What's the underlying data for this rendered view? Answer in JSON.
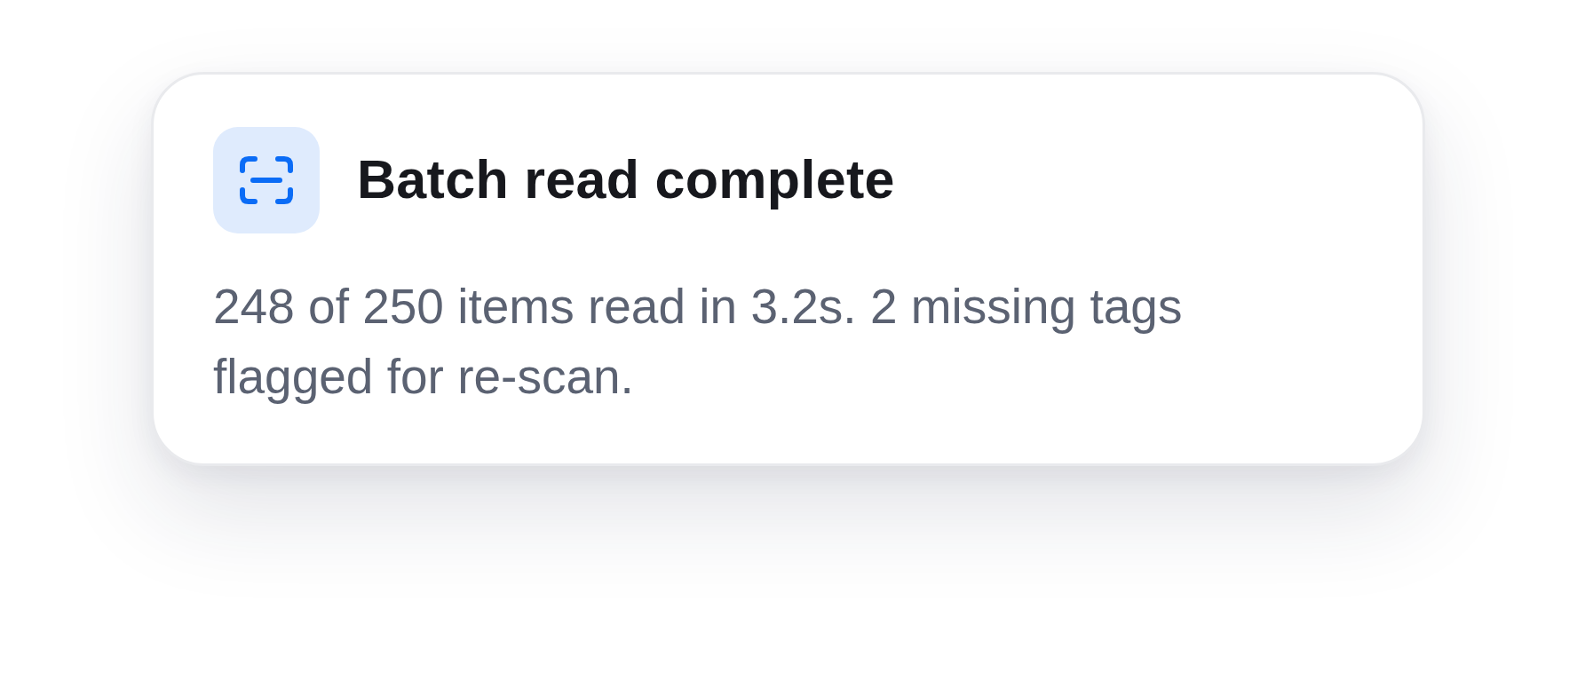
{
  "toast": {
    "title": "Batch read complete",
    "message": "248 of 250 items read in 3.2s. 2 missing tags flagged for re-scan."
  }
}
